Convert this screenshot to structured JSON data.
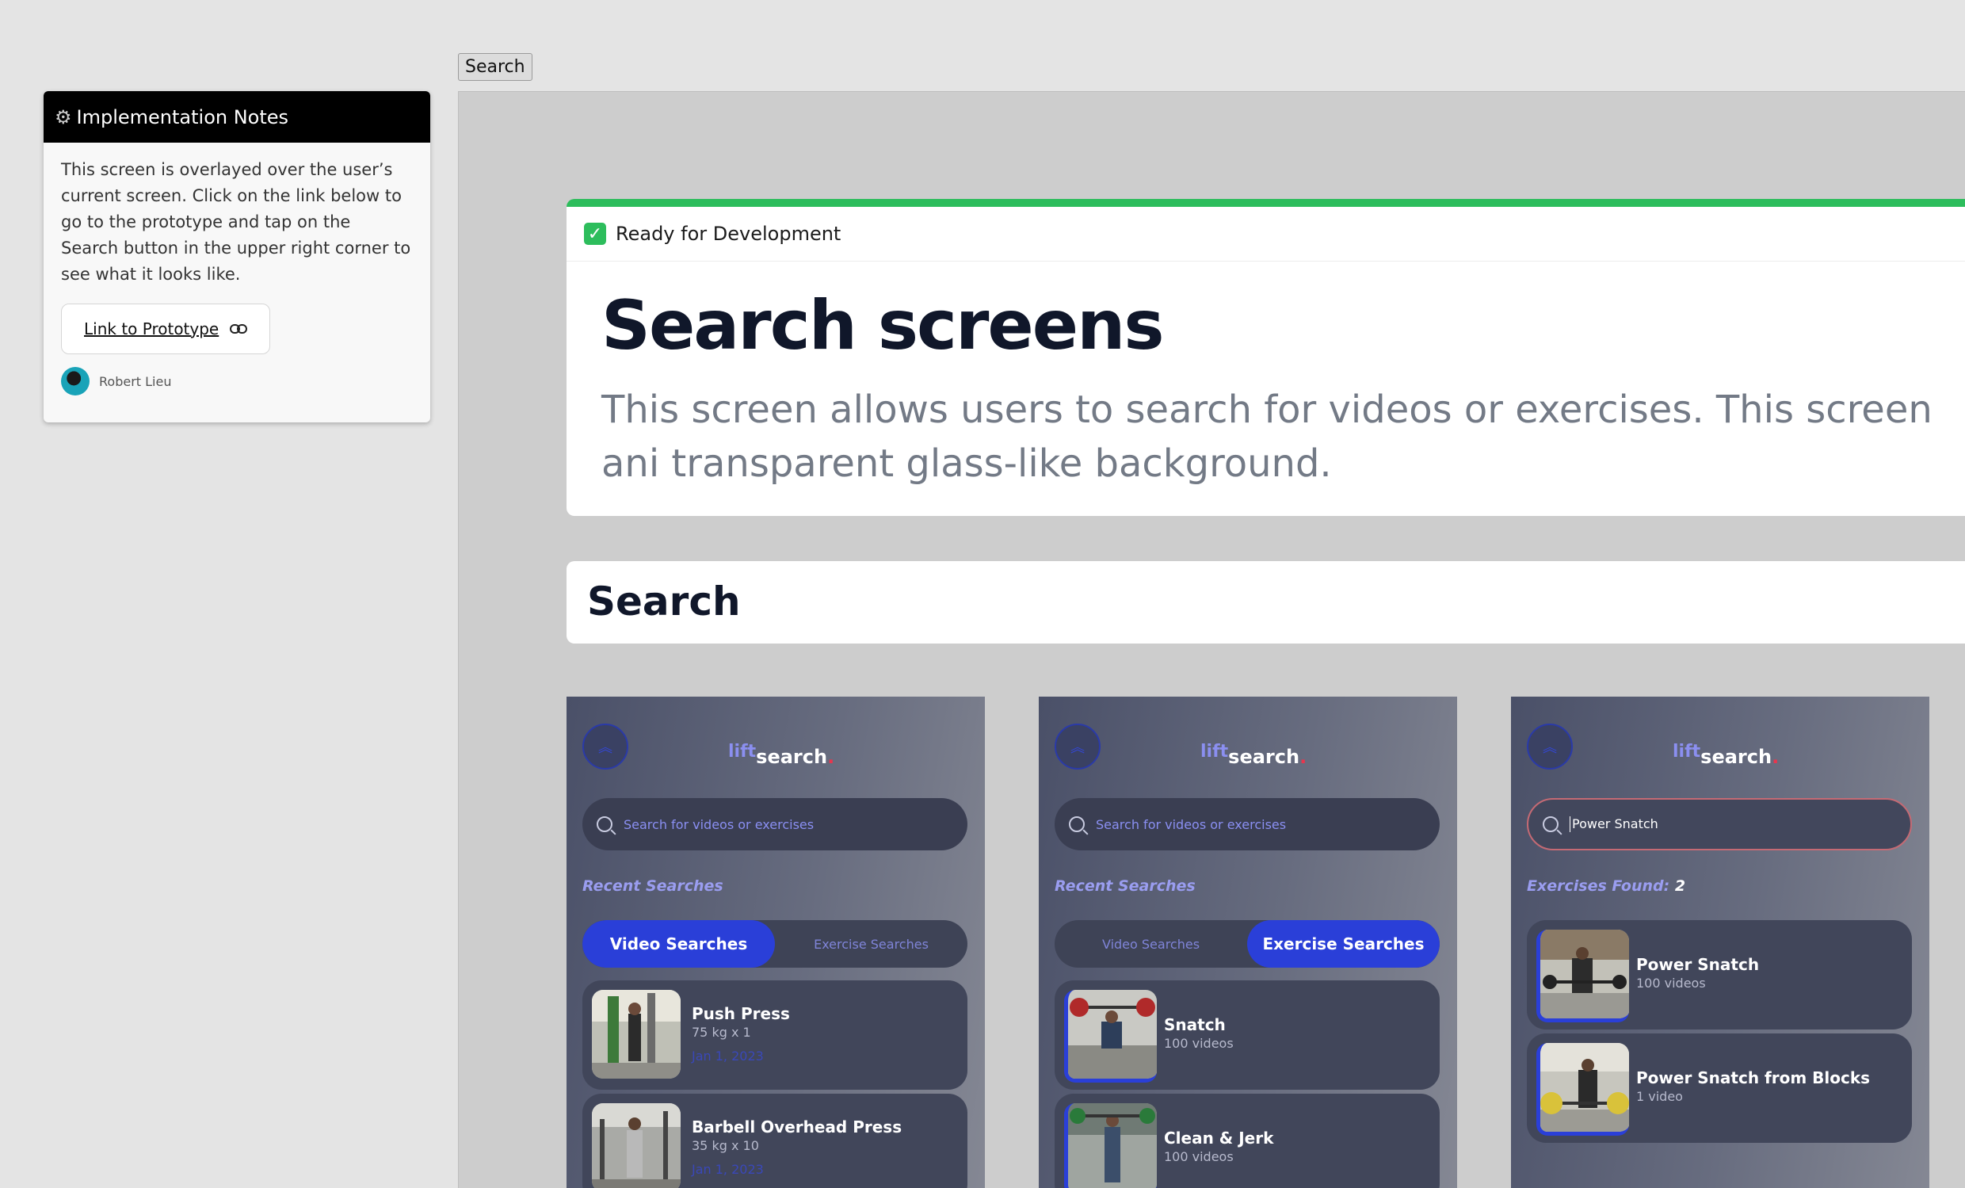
{
  "toolbar": {
    "search_label": "Search"
  },
  "notes": {
    "title": "Implementation Notes",
    "body": "This screen is overlayed over the user’s current screen. Click on the link below to go to the prototype and tap on the Search button in the upper right corner to see what it looks like.",
    "link_label": "Link to Prototype",
    "author": "Robert Lieu"
  },
  "status": {
    "label": "Ready for Development"
  },
  "page": {
    "title": "Search screens",
    "description": "This screen allows users to search for videos or exercises. This screen ani transparent glass-like background.",
    "section_title": "Search"
  },
  "phones": [
    {
      "logo_lift": "lift",
      "logo_search": "search",
      "logo_dot": ".",
      "search_placeholder": "Search for videos or exercises",
      "subheading": "Recent Searches",
      "toggle": [
        "Video Searches",
        "Exercise Searches"
      ],
      "items": [
        {
          "title": "Push Press",
          "sub": "75 kg x 1",
          "date": "Jan 1, 2023"
        },
        {
          "title": "Barbell Overhead Press",
          "sub": "35 kg x 10",
          "date": "Jan 1, 2023"
        }
      ]
    },
    {
      "logo_lift": "lift",
      "logo_search": "search",
      "logo_dot": ".",
      "search_placeholder": "Search for videos or exercises",
      "subheading": "Recent Searches",
      "toggle": [
        "Video Searches",
        "Exercise Searches"
      ],
      "items": [
        {
          "title": "Snatch",
          "sub": "100 videos"
        },
        {
          "title": "Clean & Jerk",
          "sub": "100 videos"
        }
      ]
    },
    {
      "logo_lift": "lift",
      "logo_search": "search",
      "logo_dot": ".",
      "search_value": "Power Snatch",
      "subheading": "Exercises Found:",
      "subheading_count": "2",
      "items": [
        {
          "title": "Power Snatch",
          "sub": "100 videos"
        },
        {
          "title": "Power Snatch from Blocks",
          "sub": "1 video"
        }
      ]
    }
  ],
  "colors": {
    "accent": "#2a3fd8",
    "ready": "#2dbd5c",
    "logo_dot": "#e8364e"
  }
}
